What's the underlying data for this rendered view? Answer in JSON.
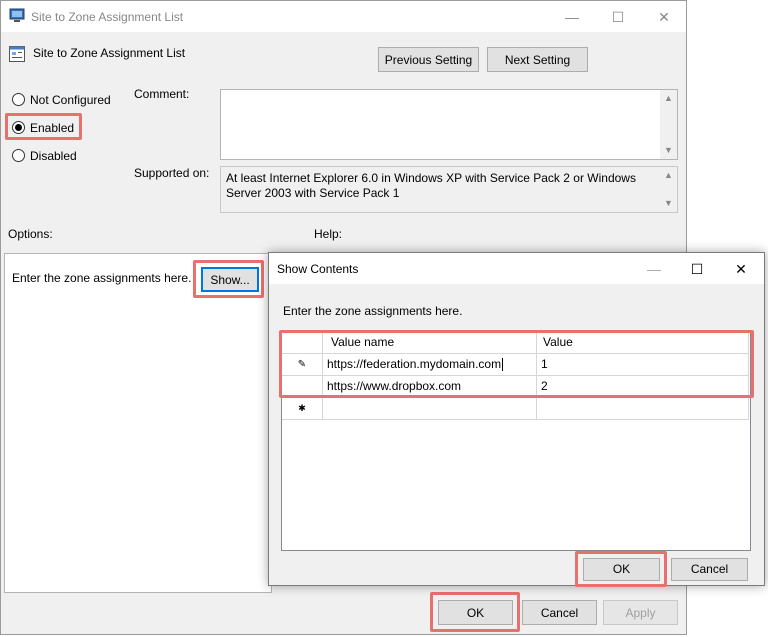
{
  "window": {
    "title": "Site to Zone Assignment List",
    "setting_name": "Site to Zone Assignment List",
    "minimize": "—",
    "maximize": "☐",
    "close": "✕"
  },
  "nav": {
    "previous": "Previous Setting",
    "next": "Next Setting"
  },
  "state": {
    "not_configured": "Not Configured",
    "enabled": "Enabled",
    "disabled": "Disabled",
    "selected": "Enabled"
  },
  "comment": {
    "label": "Comment:",
    "value": ""
  },
  "supported": {
    "label": "Supported on:",
    "value": "At least Internet Explorer 6.0 in Windows XP with Service Pack 2 or Windows Server 2003 with Service Pack 1"
  },
  "options": {
    "label": "Options:",
    "text": "Enter the zone assignments here.",
    "show_button": "Show..."
  },
  "help": {
    "label": "Help:"
  },
  "footer": {
    "ok": "OK",
    "cancel": "Cancel",
    "apply": "Apply"
  },
  "dialog": {
    "title": "Show Contents",
    "minimize": "—",
    "maximize": "☐",
    "close": "✕",
    "instruction": "Enter the zone assignments here.",
    "columns": [
      "Value name",
      "Value"
    ],
    "rows": [
      {
        "marker": "✎",
        "name": "https://federation.mydomain.com",
        "value": "1"
      },
      {
        "marker": "",
        "name": "https://www.dropbox.com",
        "value": "2"
      },
      {
        "marker": "✱",
        "name": "",
        "value": ""
      }
    ],
    "ok": "OK",
    "cancel": "Cancel"
  },
  "colors": {
    "highlight": "#e8716e",
    "focus": "#0078d7"
  }
}
